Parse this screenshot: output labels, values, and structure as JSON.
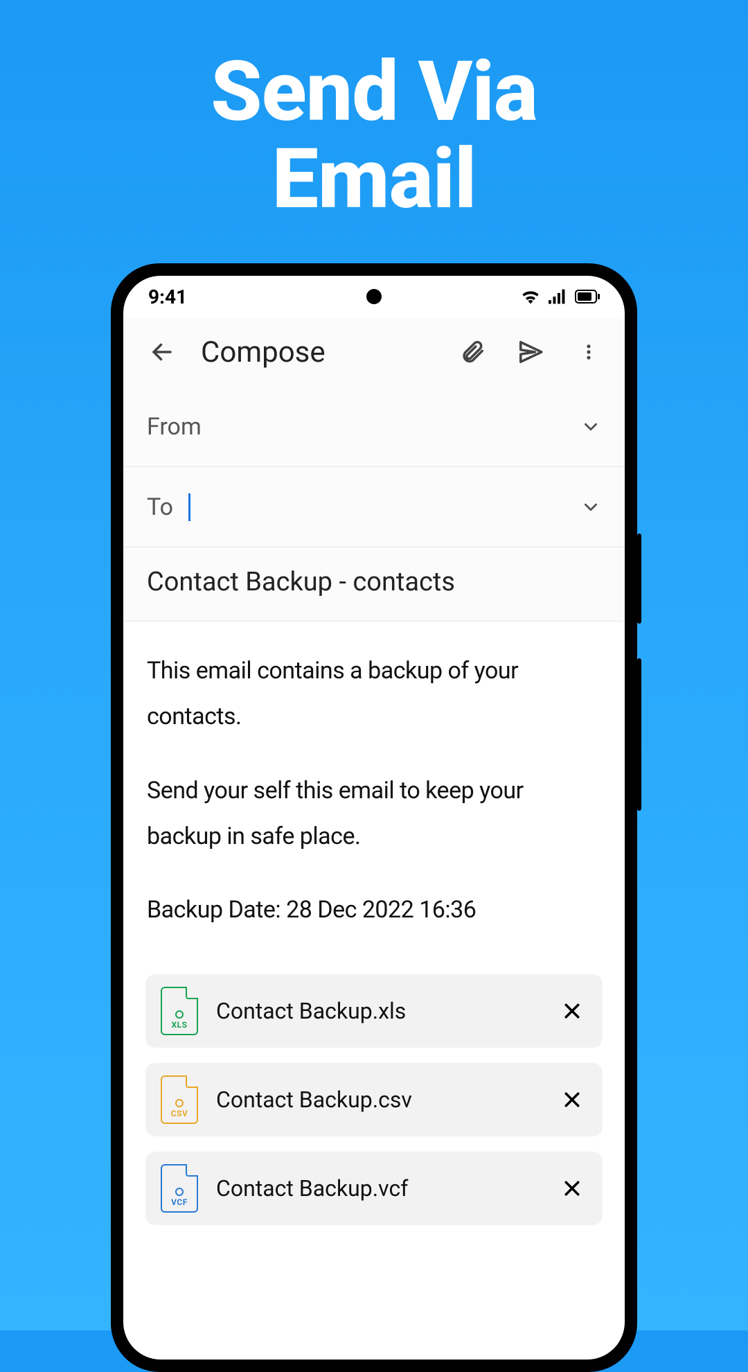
{
  "promo": {
    "line1": "Send Via",
    "line2": "Email"
  },
  "status_bar": {
    "time": "9:41"
  },
  "app_bar": {
    "title": "Compose"
  },
  "fields": {
    "from_label": "From",
    "to_label": "To"
  },
  "subject": "Contact Backup - contacts",
  "body": {
    "p1": "This email contains a backup of your contacts.",
    "p2": "Send your self this email to keep your backup in safe place.",
    "p3": "Backup Date: 28 Dec 2022 16:36"
  },
  "attachments": [
    {
      "name": "Contact Backup.xls",
      "ext": "XLS",
      "type": "xls"
    },
    {
      "name": "Contact Backup.csv",
      "ext": "CSV",
      "type": "csv"
    },
    {
      "name": "Contact Backup.vcf",
      "ext": "VCF",
      "type": "vcf"
    }
  ]
}
